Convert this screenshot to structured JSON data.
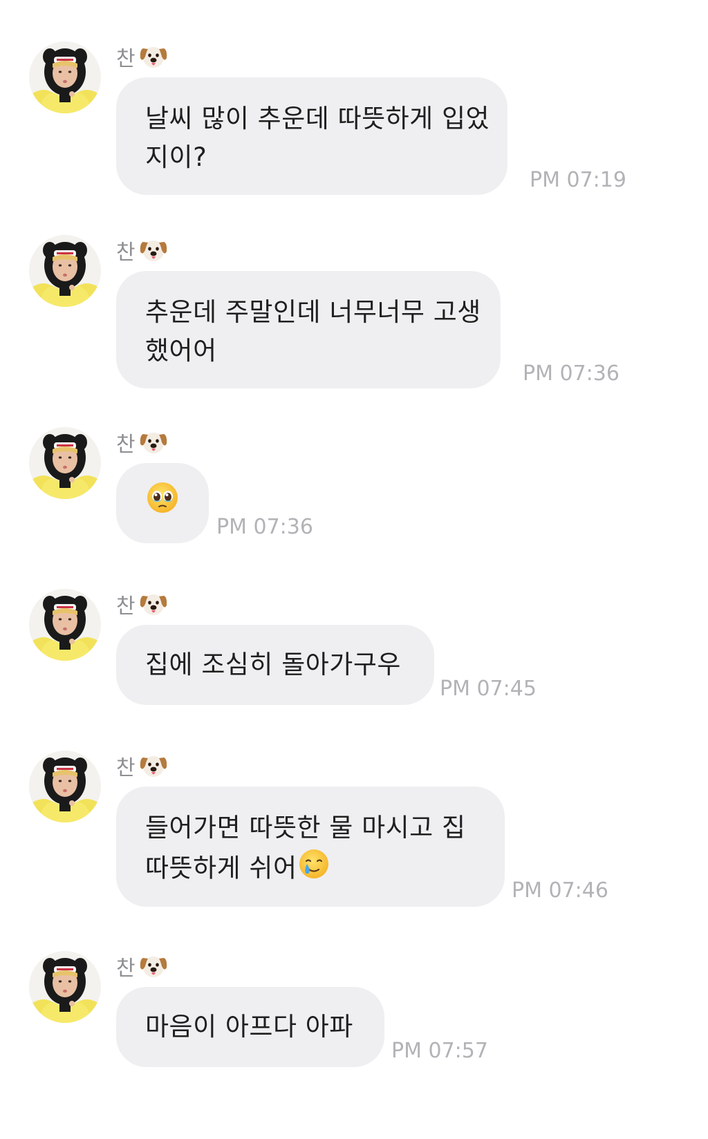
{
  "sender_name": "찬",
  "sender_emoji_icon": "dog-face-icon",
  "avatar_icon": "profile-photo-avatar",
  "colors": {
    "bubble": "#efeff2",
    "timestamp": "#b3b3b7",
    "name": "#8e8e93",
    "text": "#1f1f1f"
  },
  "messages": [
    {
      "lines": [
        "날씨 많이 추운데 따뜻하게 입었",
        "지이?"
      ],
      "time": "PM 07:19"
    },
    {
      "lines": [
        "추운데 주말인데 너무너무 고생",
        "했어어"
      ],
      "time": "PM 07:36"
    },
    {
      "lines": [
        ""
      ],
      "emoji": "pleading-face-icon",
      "time": "PM 07:36"
    },
    {
      "lines": [
        "집에 조심히 돌아가구우"
      ],
      "time": "PM 07:45"
    },
    {
      "lines": [
        "들어가면 따뜻한 물 마시고 집",
        "따뜻하게 쉬어"
      ],
      "trailing_emoji": "smiling-face-with-tear-icon",
      "time": "PM 07:46"
    },
    {
      "lines": [
        "마음이 아프다 아파"
      ],
      "time": "PM 07:57"
    }
  ]
}
